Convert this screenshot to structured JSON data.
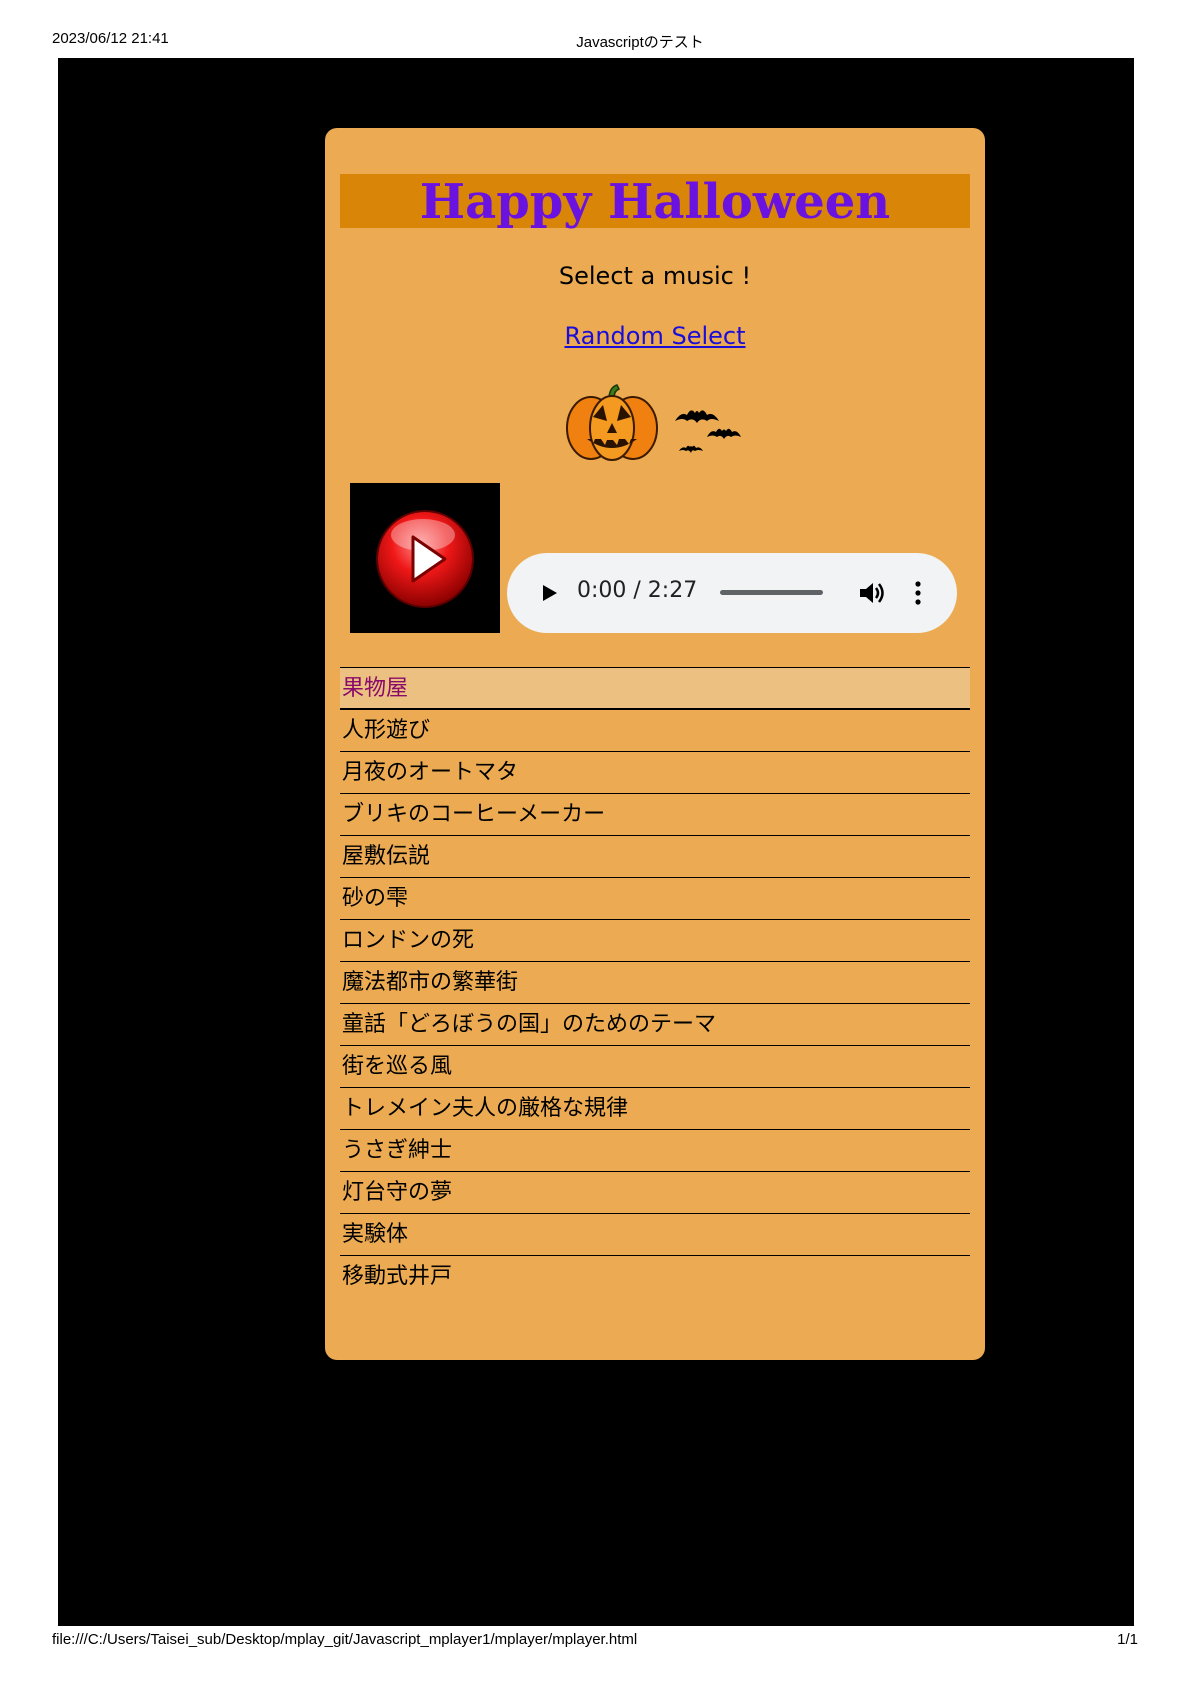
{
  "print": {
    "datetime": "2023/06/12 21:41",
    "document_title": "Javascriptのテスト",
    "file_path": "file:///C:/Users/Taisei_sub/Desktop/mplay_git/Javascript_mplayer1/mplayer/mplayer.html",
    "page_number": "1/1"
  },
  "player": {
    "title": "Happy Halloween",
    "prompt": "Select a music !",
    "random_link": "Random Select",
    "decorations": [
      "jack-o-lantern-icon",
      "bats-icon"
    ],
    "play_button_icon": "play-icon"
  },
  "audio": {
    "time_display": "0:00 / 2:27",
    "current_time": "0:00",
    "duration": "2:27",
    "progress": 0
  },
  "tracks": {
    "selected_index": 0,
    "items": [
      "果物屋",
      "人形遊び",
      "月夜のオートマタ",
      "ブリキのコーヒーメーカー",
      "屋敷伝説",
      "砂の雫",
      "ロンドンの死",
      "魔法都市の繁華街",
      "童話「どろぼうの国」のためのテーマ",
      "街を巡る風",
      "トレメイン夫人の厳格な規律",
      "うさぎ紳士",
      "灯台守の夢",
      "実験体",
      "移動式井戸"
    ]
  },
  "colors": {
    "page_background": "#000000",
    "card_background": "#ecab52",
    "title_bar": "#d98507",
    "title_text": "#6a12e0",
    "link": "#1a0dd9",
    "selected_track_background": "#ecc081",
    "selected_track_text": "#8a0a6a"
  }
}
